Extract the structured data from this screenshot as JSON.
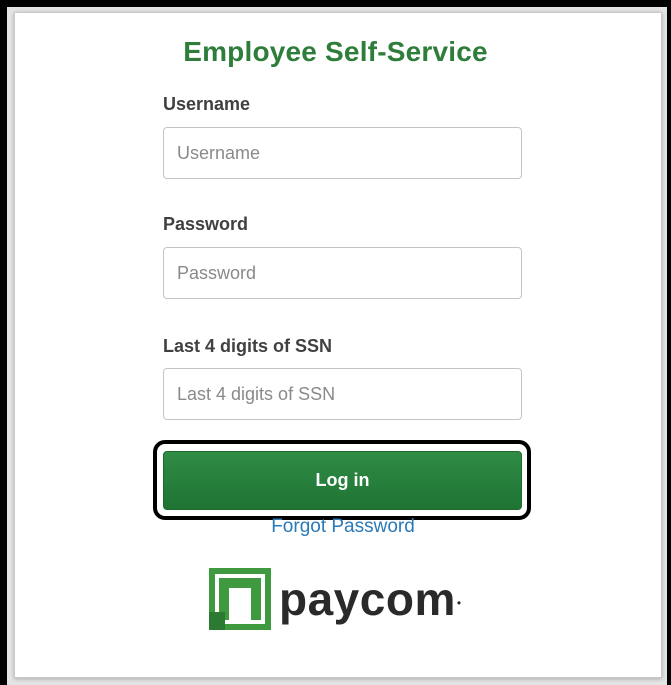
{
  "form": {
    "title": "Employee Self-Service",
    "username_label": "Username",
    "username_placeholder": "Username",
    "username_value": "",
    "password_label": "Password",
    "password_placeholder": "Password",
    "password_value": "",
    "ssn_label": "Last 4 digits of SSN",
    "ssn_placeholder": "Last 4 digits of SSN",
    "ssn_value": "",
    "login_label": "Log in",
    "forgot_label": "Forgot Password"
  },
  "brand": {
    "logo_text": "paycom",
    "logo_icon": "paycom-logo-icon",
    "accent_color": "#2e7d3a",
    "link_color": "#2b7ab8"
  }
}
